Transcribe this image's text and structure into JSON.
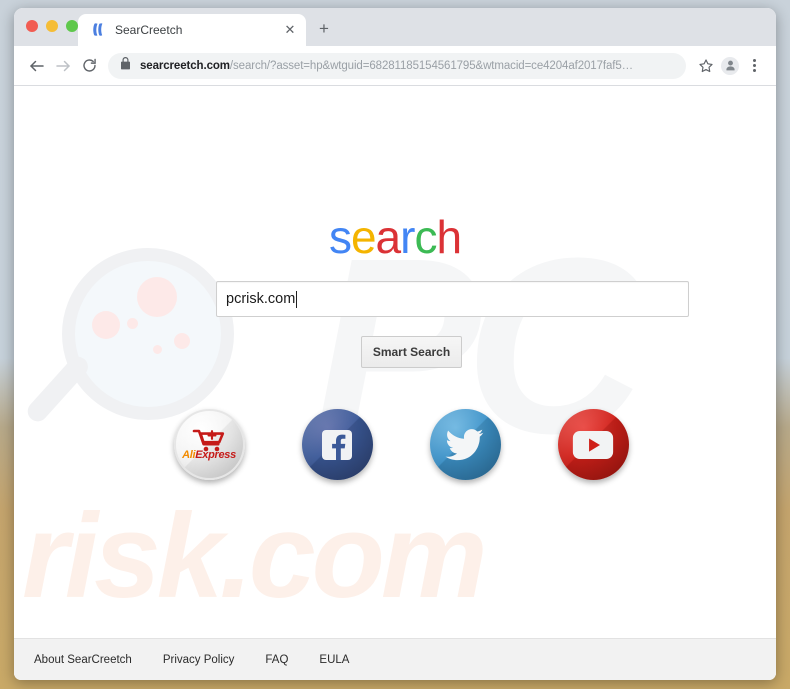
{
  "browser": {
    "traffic_lights": [
      {
        "name": "close",
        "color": "#f15c52"
      },
      {
        "name": "minimize",
        "color": "#f5bd36"
      },
      {
        "name": "zoom",
        "color": "#5fc84c"
      }
    ],
    "tab": {
      "title": "SearCreetch",
      "favicon_name": "searcreetch-favicon",
      "close_label": "✕"
    },
    "new_tab_label": "+",
    "nav": {
      "back_icon": "back-arrow-icon",
      "forward_icon": "forward-arrow-icon",
      "reload_icon": "reload-icon"
    },
    "omnibox": {
      "lock_icon": "lock-icon",
      "url_domain": "searcreetch.com",
      "url_path": "/search/?asset=hp&wtguid=68281185154561795&wtmacid=ce4204af2017faf5…",
      "full_url": "searcreetch.com/search/?asset=hp&wtguid=68281185154561795&wtmacid=ce4204af2017faf5…"
    },
    "actions": {
      "bookmark_icon": "star-icon",
      "profile_icon": "avatar-icon",
      "menu_icon": "three-dot-menu-icon"
    }
  },
  "page": {
    "logo": {
      "letters": [
        {
          "char": "s",
          "color": "#4285f4"
        },
        {
          "char": "e",
          "color": "#f4b400"
        },
        {
          "char": "a",
          "color": "#db3236"
        },
        {
          "char": "r",
          "color": "#4285f4"
        },
        {
          "char": "c",
          "color": "#3cba54"
        },
        {
          "char": "h",
          "color": "#db3236"
        }
      ],
      "text": "search"
    },
    "search": {
      "value": "pcrisk.com",
      "placeholder": "",
      "button_label": "Smart Search"
    },
    "shortcuts": [
      {
        "name": "aliexpress",
        "label_a": "Ali",
        "label_b": "Express",
        "color": "#c51a18"
      },
      {
        "name": "facebook",
        "label": "Facebook",
        "color": "#3b5998"
      },
      {
        "name": "twitter",
        "label": "Twitter",
        "color": "#3d92c8"
      },
      {
        "name": "youtube",
        "label": "YouTube",
        "color": "#cf2019"
      }
    ],
    "watermarks": {
      "pc": "PC",
      "risk": "risk.com"
    }
  },
  "footer": {
    "links": [
      {
        "label": "About SearCreetch"
      },
      {
        "label": "Privacy Policy"
      },
      {
        "label": "FAQ"
      },
      {
        "label": "EULA"
      }
    ]
  }
}
